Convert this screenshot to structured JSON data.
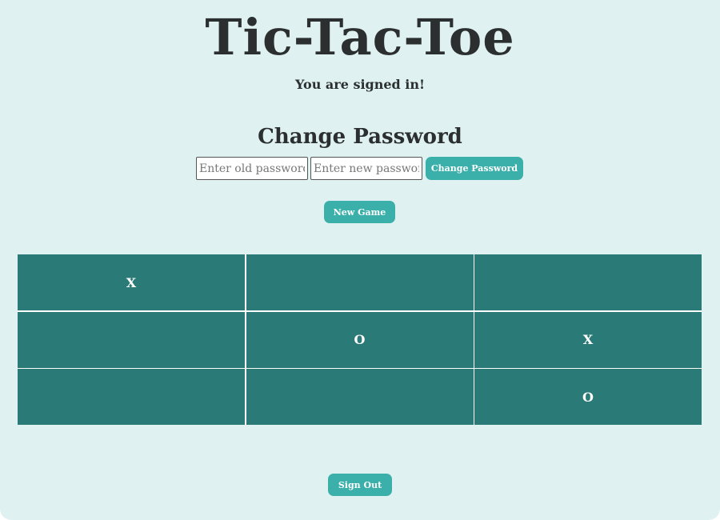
{
  "header": {
    "title": "Tic-Tac-Toe",
    "status": "You are signed in!"
  },
  "change_password": {
    "heading": "Change Password",
    "old_placeholder": "Enter old password",
    "new_placeholder": "Enter new password",
    "old_value": "",
    "new_value": "",
    "submit_label": "Change Password"
  },
  "controls": {
    "new_game_label": "New Game",
    "sign_out_label": "Sign Out"
  },
  "board": {
    "cells": [
      "X",
      "",
      "",
      "",
      "O",
      "X",
      "",
      "",
      "O"
    ]
  },
  "colors": {
    "background": "#dff1f1",
    "accent": "#3bb0aa",
    "board_cell": "#2a7a77",
    "text": "#2b2f2f"
  }
}
